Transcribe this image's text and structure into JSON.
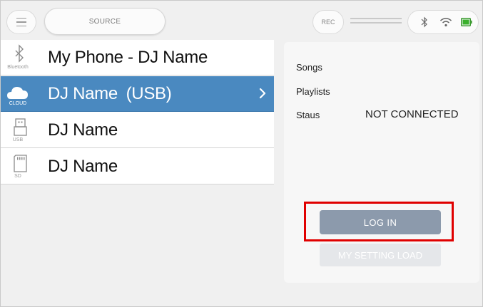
{
  "topbar": {
    "source_label": "SOURCE",
    "rec_label": "REC",
    "icons": [
      "menu-icon",
      "bluetooth-icon",
      "wifi-icon",
      "battery-icon"
    ]
  },
  "sources": [
    {
      "name": "My Phone - DJ Name",
      "sub": "Bluetooth",
      "icon": "bluetooth-icon",
      "selected": false
    },
    {
      "name": "DJ Name (USB)",
      "sub": "CLOUD",
      "icon": "cloud-icon",
      "selected": true
    },
    {
      "name": "DJ Name",
      "sub": "USB",
      "icon": "usb-icon",
      "selected": false
    },
    {
      "name": "DJ Name",
      "sub": "SD",
      "icon": "sd-card-icon",
      "selected": false
    }
  ],
  "info": {
    "songs_label": "Songs",
    "playlists_label": "Playlists",
    "status_label": "Staus",
    "status_value": "NOT CONNECTED",
    "login_label": "LOG IN",
    "setting_load_label": "MY SETTING LOAD"
  },
  "colors": {
    "selected_row": "#4a89c0",
    "login_button": "#8c9aac",
    "highlight": "#e00000"
  }
}
